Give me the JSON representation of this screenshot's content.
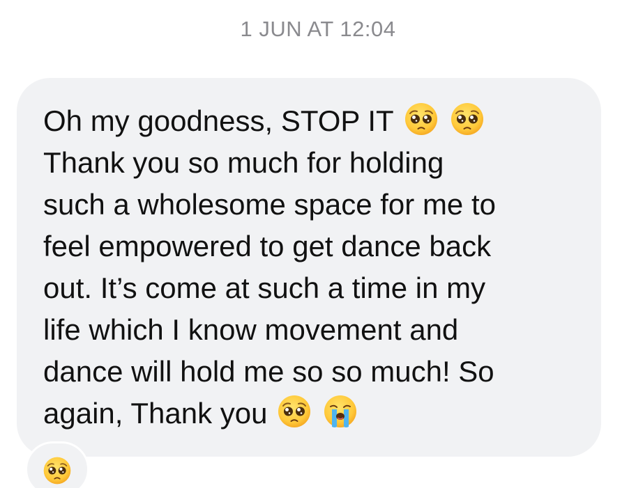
{
  "thread": {
    "timestamp": "1 JUN AT 12:04"
  },
  "message": {
    "lines": [
      "Oh my goodness, STOP IT",
      "Thank you so much for holding",
      "such a wholesome space for me to",
      "feel empowered to get dance back",
      "out. It’s come at such a time in my",
      "life which I know movement and",
      "dance will hold me so so much! So",
      "again, Thank you"
    ],
    "inline_emojis": {
      "line_1": [
        "pleading-face",
        "pleading-face"
      ],
      "line_8": [
        "pleading-face",
        "loudly-crying-face"
      ]
    },
    "bubble_color": "#f1f2f4",
    "text_color": "#111111"
  },
  "reaction": {
    "emoji": "pleading-face"
  },
  "colors": {
    "timestamp": "#8a8a8e",
    "emoji_face": "#ffcf3f"
  }
}
